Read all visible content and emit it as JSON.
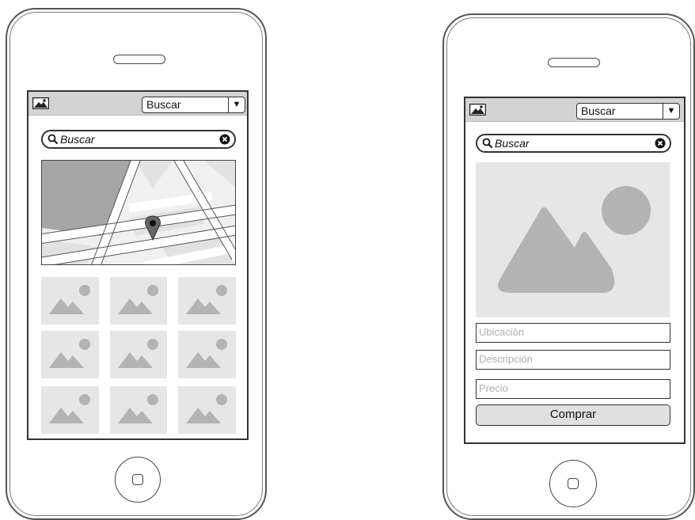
{
  "left_screen": {
    "dropdown_value": "Buscar",
    "search_text": "Buscar",
    "thumbnails": [
      "image",
      "image",
      "image",
      "image",
      "image",
      "image",
      "image",
      "image",
      "image"
    ]
  },
  "right_screen": {
    "dropdown_value": "Buscar",
    "search_text": "Buscar",
    "fields": {
      "location_placeholder": "Ubicación",
      "description_placeholder": "Descripción",
      "price_placeholder": "Precio"
    },
    "buy_label": "Comprar"
  },
  "colors": {
    "topbar": "#d3d3d3",
    "placeholder_bg": "#e6e6e6",
    "placeholder_shape": "#b3b3b3",
    "map_block": "#a6a6a6",
    "button_bg": "#e0e0e0"
  }
}
